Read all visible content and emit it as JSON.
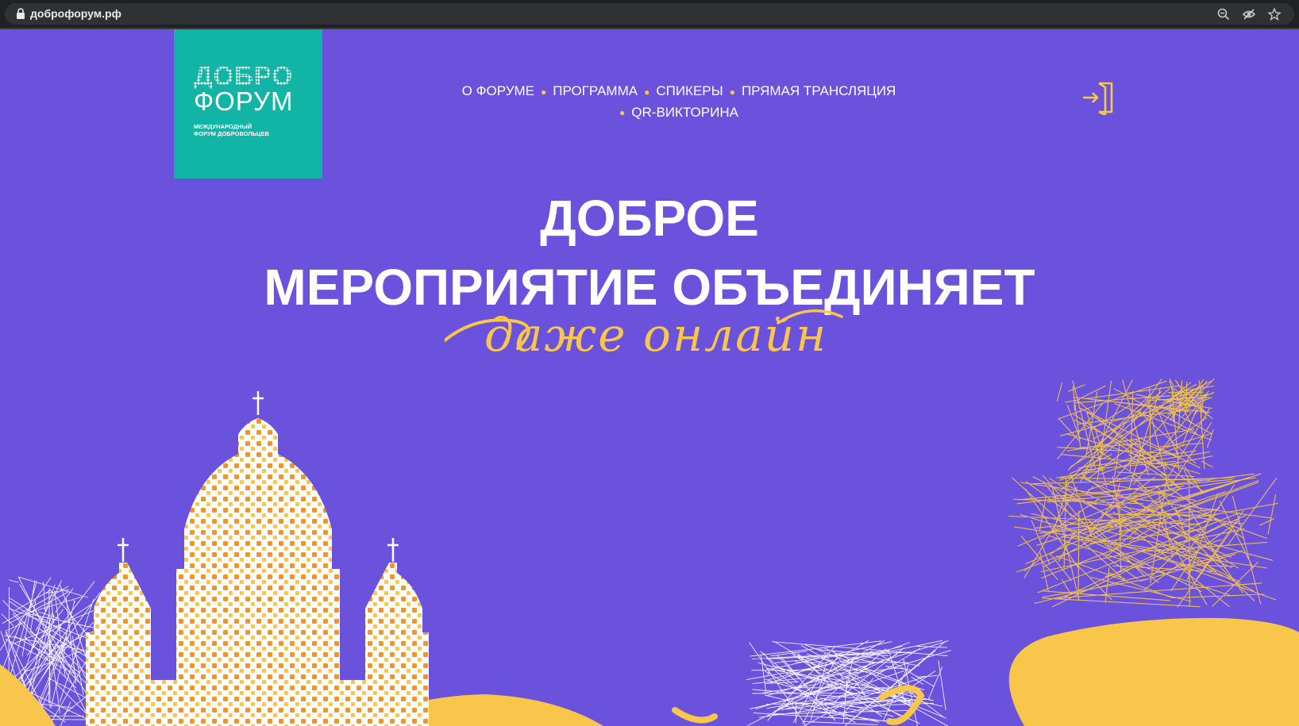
{
  "browser": {
    "url": "доброфорум.рф",
    "icons": [
      "lock-icon",
      "zoom-out-icon",
      "eye-off-icon",
      "star-icon"
    ]
  },
  "logo": {
    "word_top": "ДОБРО",
    "word_bottom": "ФОРУМ",
    "sub_line1": "МЕЖДУНАРОДНЫЙ",
    "sub_line2": "ФОРУМ ДОБРОВОЛЬЦЕВ"
  },
  "nav": {
    "items": [
      {
        "label": "О ФОРУМЕ"
      },
      {
        "label": "ПРОГРАММА"
      },
      {
        "label": "СПИКЕРЫ"
      },
      {
        "label": "ПРЯМАЯ ТРАНСЛЯЦИЯ"
      },
      {
        "label": "QR-ВИКТОРИНА"
      }
    ],
    "login_icon": "login-icon"
  },
  "hero": {
    "line1": "ДОБРОЕ",
    "line2": "МЕРОПРИЯТИЕ ОБЪЕДИНЯЕТ",
    "script": "даже онлайн"
  },
  "colors": {
    "background": "#6a52dc",
    "logo_bg": "#12b5a5",
    "accent": "#f8c64a",
    "text": "#ffffff"
  }
}
